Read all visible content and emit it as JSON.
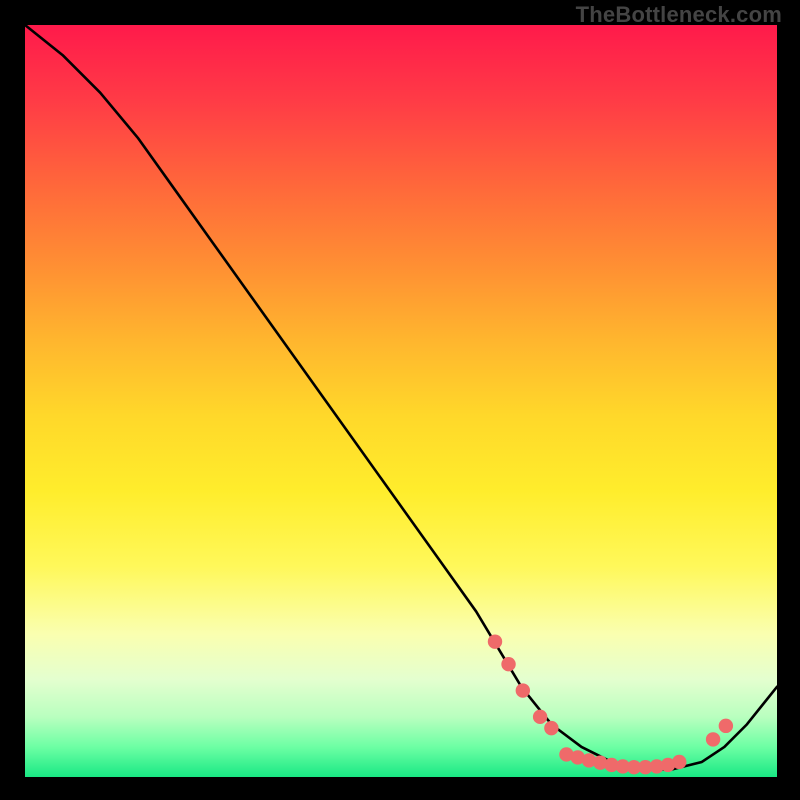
{
  "watermark": "TheBottleneck.com",
  "chart_data": {
    "type": "line",
    "title": "",
    "xlabel": "",
    "ylabel": "",
    "xlim": [
      0,
      100
    ],
    "ylim": [
      0,
      100
    ],
    "series": [
      {
        "name": "curve",
        "x": [
          0,
          5,
          10,
          15,
          20,
          25,
          30,
          35,
          40,
          45,
          50,
          55,
          60,
          63,
          66,
          70,
          74,
          78,
          82,
          86,
          88,
          90,
          93,
          96,
          100
        ],
        "y": [
          100,
          96,
          91,
          85,
          78,
          71,
          64,
          57,
          50,
          43,
          36,
          29,
          22,
          17,
          12,
          7,
          4,
          2,
          1,
          1,
          1.5,
          2,
          4,
          7,
          12
        ]
      }
    ],
    "markers": [
      {
        "x": 62.5,
        "y": 18.0
      },
      {
        "x": 64.3,
        "y": 15.0
      },
      {
        "x": 66.2,
        "y": 11.5
      },
      {
        "x": 68.5,
        "y": 8.0
      },
      {
        "x": 70.0,
        "y": 6.5
      },
      {
        "x": 72.0,
        "y": 3.0
      },
      {
        "x": 73.5,
        "y": 2.6
      },
      {
        "x": 75.0,
        "y": 2.2
      },
      {
        "x": 76.5,
        "y": 1.9
      },
      {
        "x": 78.0,
        "y": 1.6
      },
      {
        "x": 79.5,
        "y": 1.4
      },
      {
        "x": 81.0,
        "y": 1.3
      },
      {
        "x": 82.5,
        "y": 1.3
      },
      {
        "x": 84.0,
        "y": 1.4
      },
      {
        "x": 85.5,
        "y": 1.6
      },
      {
        "x": 87.0,
        "y": 2.0
      },
      {
        "x": 91.5,
        "y": 5.0
      },
      {
        "x": 93.2,
        "y": 6.8
      }
    ],
    "marker_color": "#ef6a6a",
    "line_color": "#000000",
    "gradient": [
      {
        "stop": 0.0,
        "color": "#ff1a4b"
      },
      {
        "stop": 0.5,
        "color": "#ffd82a"
      },
      {
        "stop": 0.85,
        "color": "#faffb0"
      },
      {
        "stop": 1.0,
        "color": "#19e884"
      }
    ]
  }
}
